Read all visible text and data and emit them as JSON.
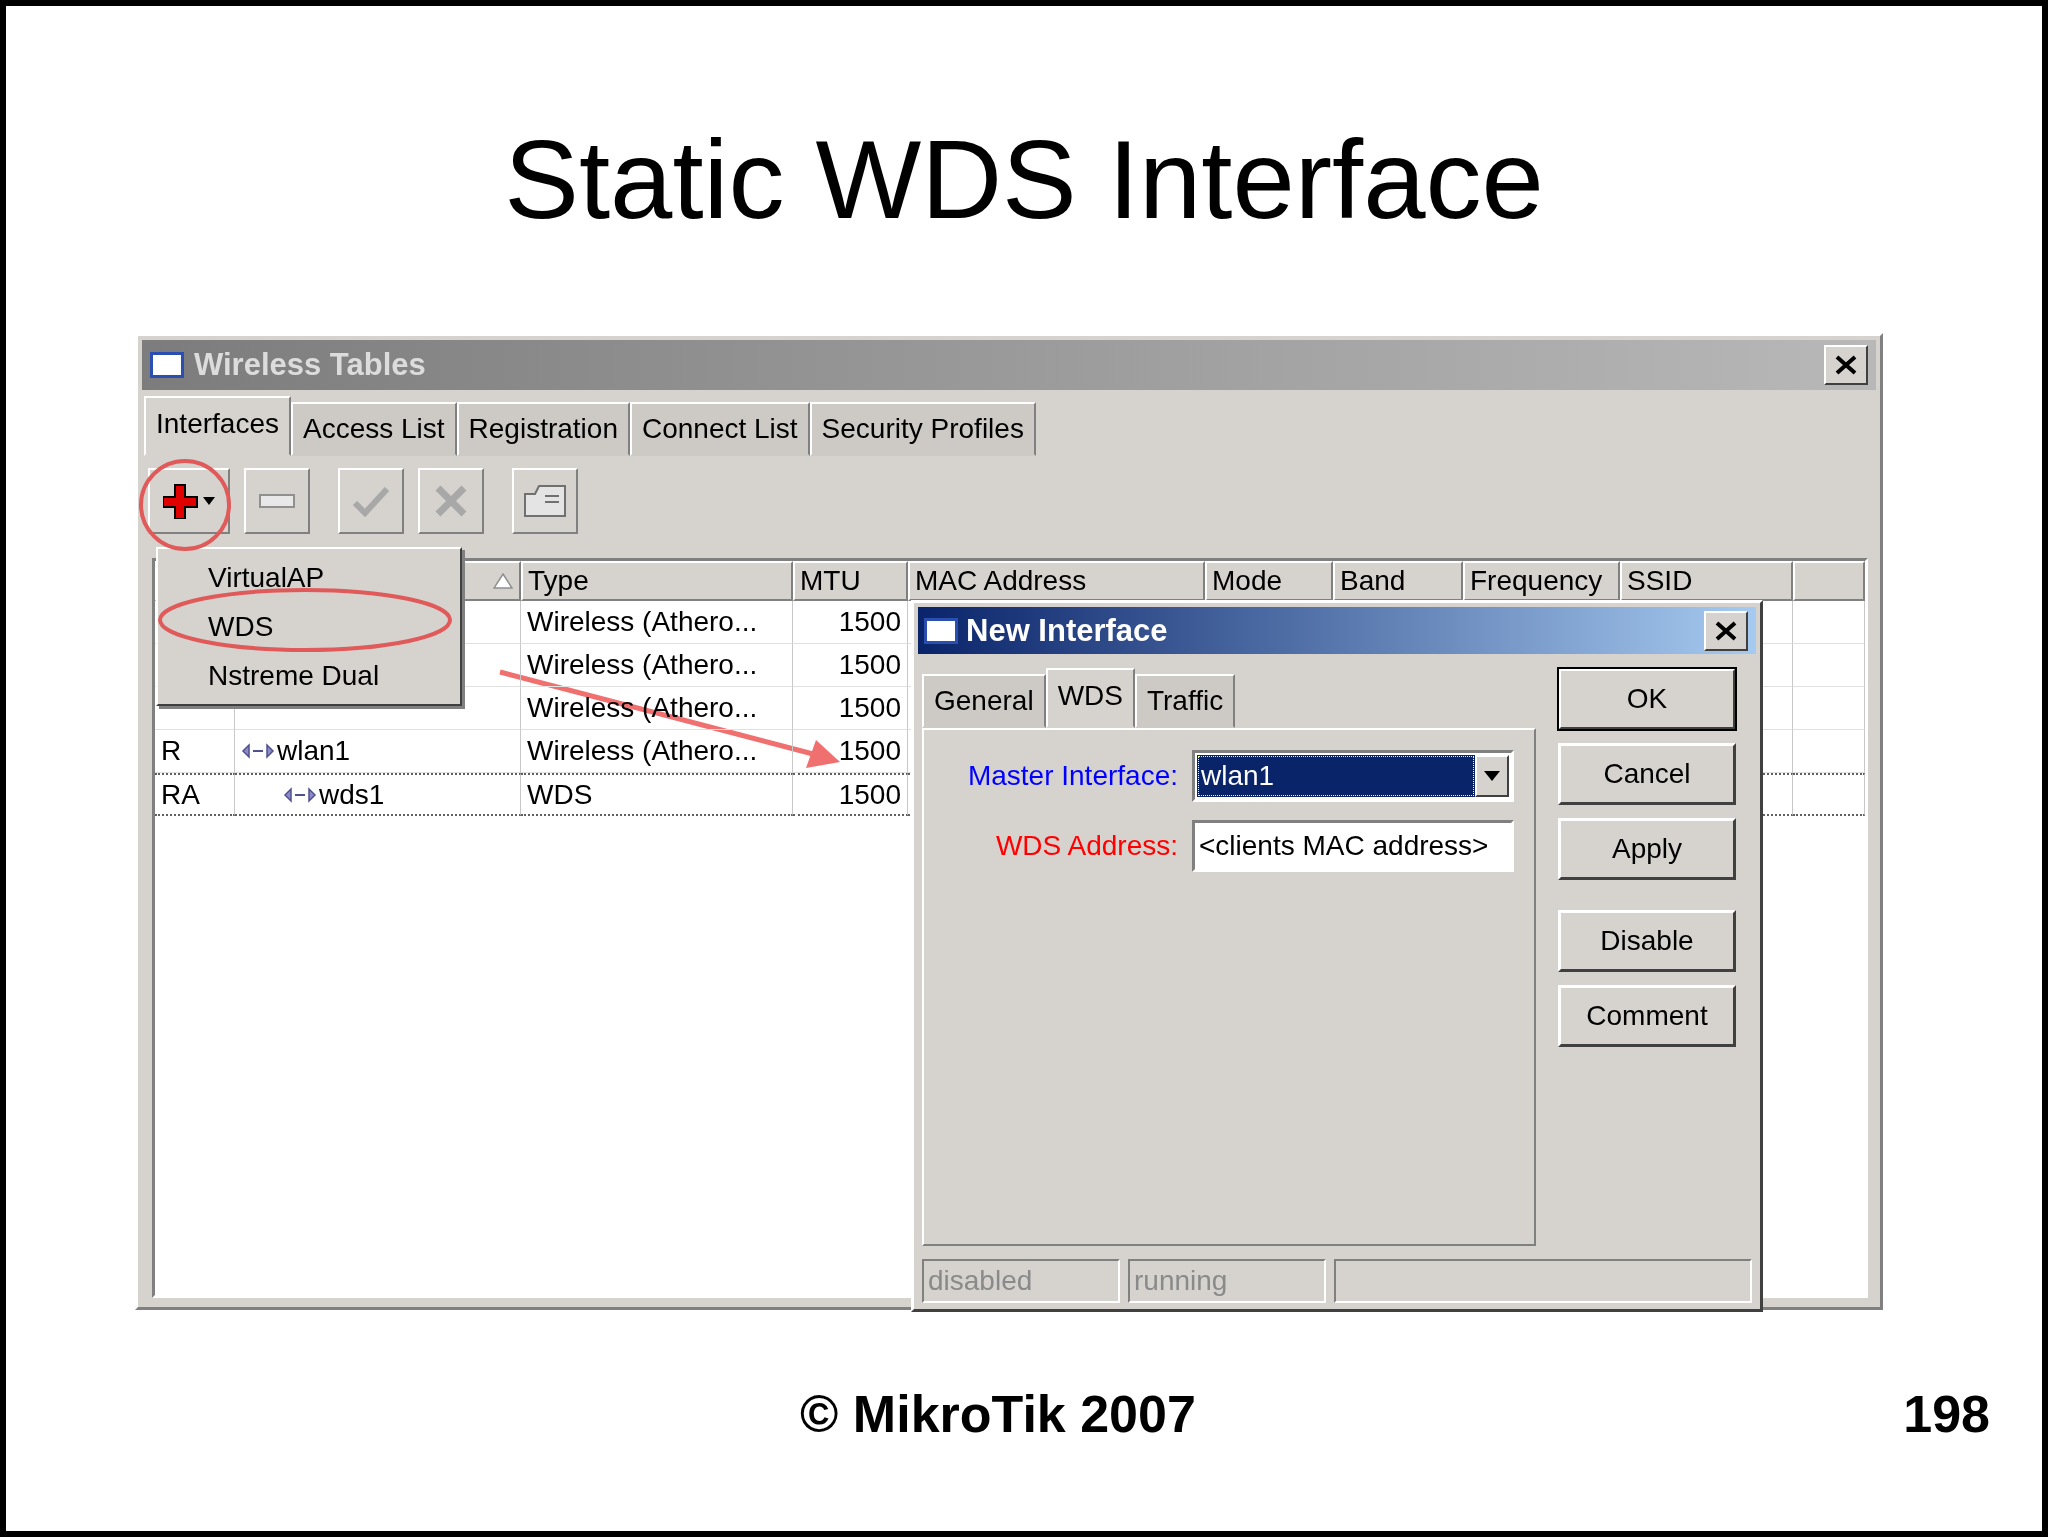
{
  "slide": {
    "title": "Static WDS Interface",
    "footer": "© MikroTik 2007",
    "page_number": "198"
  },
  "window": {
    "title": "Wireless Tables",
    "tabs": [
      {
        "label": "Interfaces",
        "selected": true
      },
      {
        "label": "Access List",
        "selected": false
      },
      {
        "label": "Registration",
        "selected": false
      },
      {
        "label": "Connect List",
        "selected": false
      },
      {
        "label": "Security Profiles",
        "selected": false
      }
    ],
    "add_menu": {
      "items": [
        {
          "label": "VirtualAP",
          "selected": false
        },
        {
          "label": "WDS",
          "selected": false
        },
        {
          "label": "Nstreme Dual",
          "selected": false
        }
      ]
    },
    "table": {
      "columns": [
        "Type",
        "MTU",
        "MAC Address",
        "Mode",
        "Band",
        "Frequency",
        "SSID"
      ],
      "rows": [
        {
          "type": "Wireless (Athero...",
          "mtu": "1500",
          "selected": false
        },
        {
          "type": "Wireless (Athero...",
          "mtu": "1500",
          "selected": false
        },
        {
          "type": "Wireless (Athero...",
          "mtu": "1500",
          "selected": false
        },
        {
          "flags": "R",
          "name": "wlan1",
          "type": "Wireless (Athero...",
          "mtu": "1500",
          "selected": false,
          "children": [
            {
              "flags": "RA",
              "name": "wds1",
              "type": "WDS",
              "mtu": "1500",
              "selected": true
            }
          ]
        }
      ]
    }
  },
  "dialog": {
    "title": "New Interface",
    "tabs": [
      {
        "label": "General",
        "selected": false
      },
      {
        "label": "WDS",
        "selected": true
      },
      {
        "label": "Traffic",
        "selected": false
      }
    ],
    "fields": [
      {
        "kind": "dropdown",
        "label": "Master Interface:",
        "color": "#0000ff",
        "value": "wlan1"
      },
      {
        "kind": "text",
        "label": "WDS Address:",
        "color": "#ff0000",
        "value": "<clients MAC address>"
      }
    ],
    "buttons": [
      {
        "label": "OK",
        "default": true
      },
      {
        "label": "Cancel",
        "default": false
      },
      {
        "label": "Apply",
        "default": false
      },
      {
        "label": "Disable",
        "default": false
      },
      {
        "label": "Comment",
        "default": false
      }
    ],
    "status": [
      "disabled",
      "running"
    ]
  }
}
